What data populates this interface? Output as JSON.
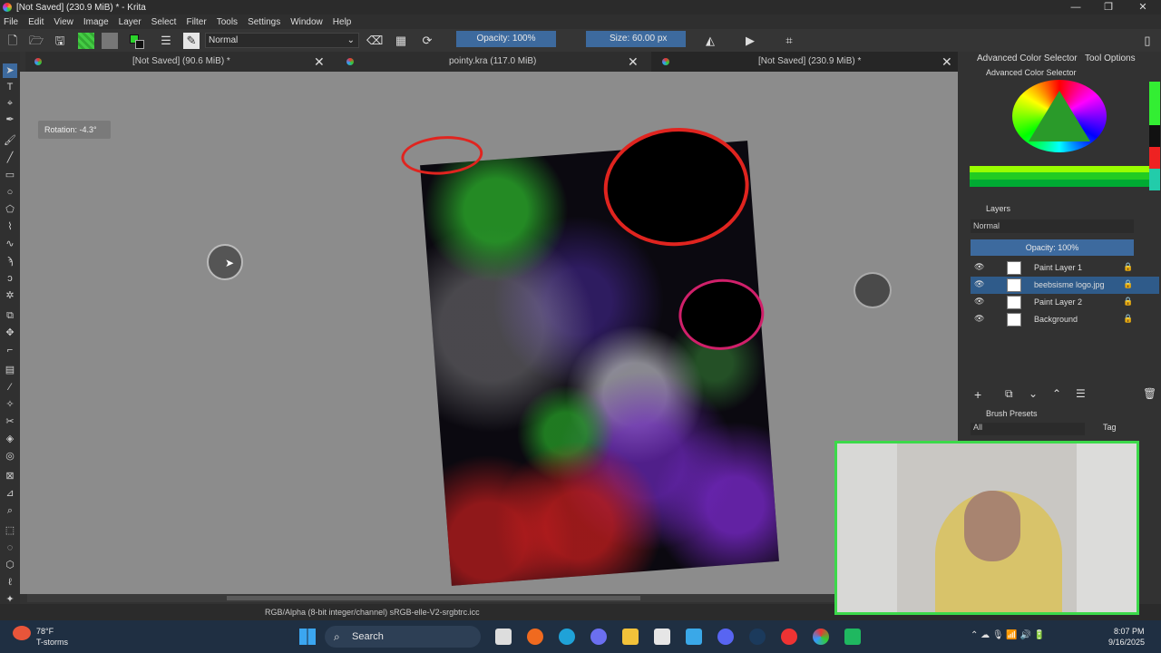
{
  "window": {
    "title": "[Not Saved]  (230.9 MiB) * - Krita",
    "controls": [
      "—",
      "❐",
      "✕"
    ]
  },
  "menu": [
    "File",
    "Edit",
    "View",
    "Image",
    "Layer",
    "Select",
    "Filter",
    "Tools",
    "Settings",
    "Window",
    "Help"
  ],
  "toolbar": {
    "blend_mode": "Normal",
    "opacity_label": "Opacity: 100%",
    "size_label": "Size: 60.00 px"
  },
  "tabs": [
    {
      "label": "[Not Saved]  (90.6 MiB) *"
    },
    {
      "label": "pointy.kra  (117.0 MiB)"
    },
    {
      "label": "[Not Saved]  (230.9 MiB) *"
    }
  ],
  "canvas": {
    "rotation_label": "Rotation: -4.3°"
  },
  "statusbar": {
    "color_profile": "RGB/Alpha (8-bit integer/channel)  sRGB-elle-V2-srgbtrc.icc"
  },
  "dock": {
    "tab_color_selector": "Advanced Color Selector",
    "tab_tool_options": "Tool Options",
    "color_selector_title": "Advanced Color Selector",
    "layers_title": "Layers",
    "layers_blend": "Normal",
    "layers_opacity": "Opacity:  100%",
    "layers": [
      {
        "name": "Paint Layer 1",
        "active": false
      },
      {
        "name": "beebsisme logo.jpg",
        "active": true
      },
      {
        "name": "Paint Layer 2",
        "active": false
      },
      {
        "name": "Background",
        "active": false
      }
    ],
    "brush_presets_title": "Brush Presets",
    "brush_filter": "All",
    "tag_label": "Tag"
  },
  "taskbar": {
    "weather_temp": "78°F",
    "weather_desc": "T-storms",
    "search_label": "Search",
    "time": "8:07 PM",
    "date": "9/16/2025"
  },
  "colors": {
    "accent": "#3d6a9e",
    "canvas_bg": "#8c8c8c",
    "webcam_border": "#3cd94a"
  }
}
